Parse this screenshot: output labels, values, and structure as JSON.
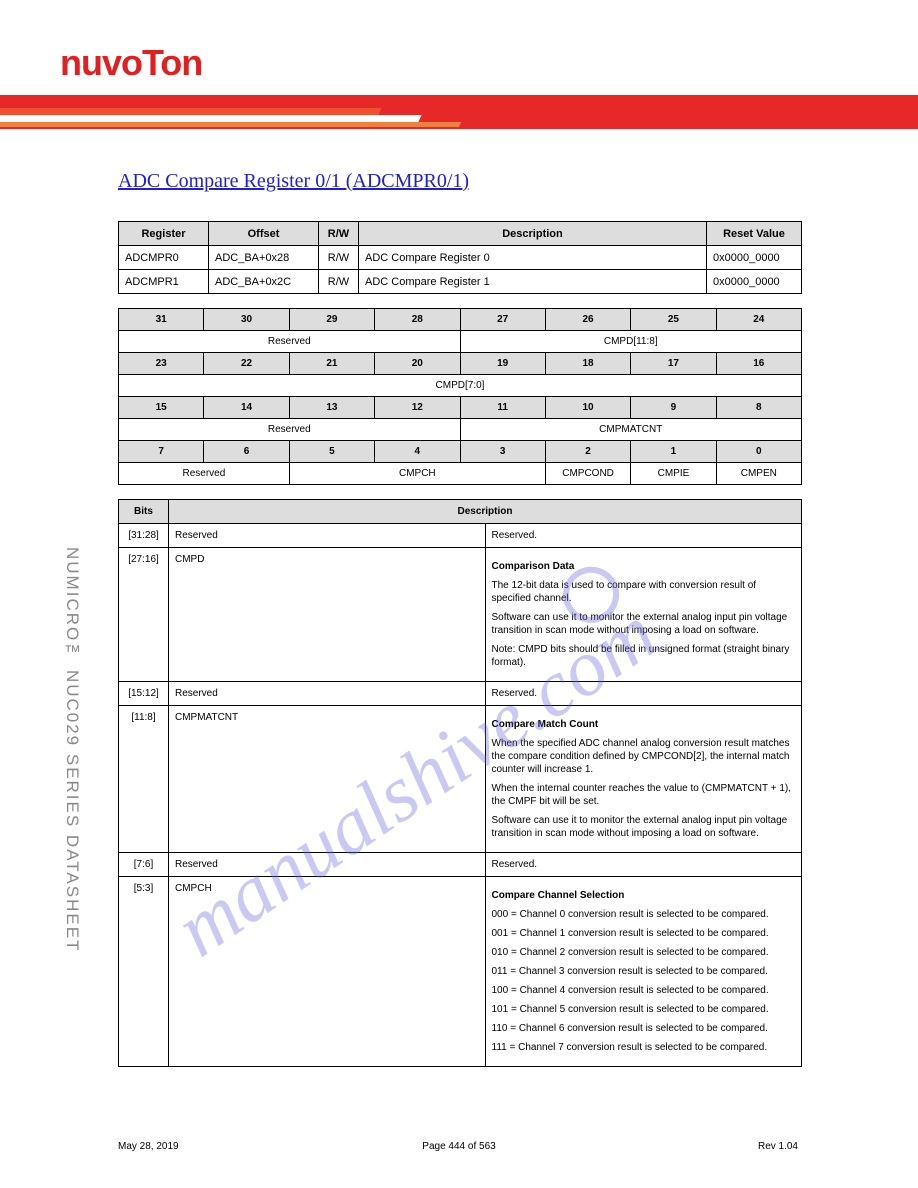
{
  "brand": "nuvoTon",
  "side_label": "NUMICRO™ NUC029 SERIES DATASHEET",
  "title_link": "ADC Compare Register 0/1 (ADCMPR0/1)",
  "watermark": "manualshive.com",
  "reg_table": {
    "headers": [
      "Register",
      "Offset",
      "R/W",
      "Description",
      "Reset Value"
    ],
    "rows": [
      [
        "ADCMPR0",
        "ADC_BA+0x28",
        "R/W",
        "ADC Compare Register 0",
        "0x0000_0000"
      ],
      [
        "ADCMPR1",
        "ADC_BA+0x2C",
        "R/W",
        "ADC Compare Register 1",
        "0x0000_0000"
      ]
    ]
  },
  "bit_table": {
    "rows": [
      {
        "hdr": [
          "31",
          "30",
          "29",
          "28",
          "27",
          "26",
          "25",
          "24"
        ],
        "val": [
          "Reserved",
          "",
          "",
          "",
          "CMPD[11:8]",
          "",
          "",
          ""
        ],
        "spans": [
          4,
          4
        ]
      },
      {
        "hdr": [
          "23",
          "22",
          "21",
          "20",
          "19",
          "18",
          "17",
          "16"
        ],
        "val": [
          "CMPD[7:0]"
        ],
        "spans": [
          8
        ]
      },
      {
        "hdr": [
          "15",
          "14",
          "13",
          "12",
          "11",
          "10",
          "9",
          "8"
        ],
        "val": [
          "Reserved",
          "",
          "",
          "",
          "CMPMATCNT",
          "",
          "",
          ""
        ],
        "spans": [
          4,
          4
        ]
      },
      {
        "hdr": [
          "7",
          "6",
          "5",
          "4",
          "3",
          "2",
          "1",
          "0"
        ],
        "val": [
          "Reserved",
          "",
          "CMPCH",
          "",
          "",
          "CMPCOND",
          "CMPIE",
          "CMPEN"
        ],
        "spans": [
          2,
          3,
          1,
          1,
          1,
          0,
          0,
          0
        ],
        "custom": true
      }
    ]
  },
  "desc_table": {
    "headers": [
      "Bits",
      "Description"
    ],
    "rows": [
      {
        "bits": "[31:28]",
        "field": "Reserved",
        "desc": [
          "Reserved."
        ]
      },
      {
        "bits": "[27:16]",
        "field": "CMPD",
        "desc": [
          "Comparison Data",
          "The 12-bit data is used to compare with conversion result of specified channel.",
          "Software can use it to monitor the external analog input pin voltage transition in scan mode without imposing a load on software.",
          "Note: CMPD bits should be filled in unsigned format (straight binary format)."
        ]
      },
      {
        "bits": "[15:12]",
        "field": "Reserved",
        "desc": [
          "Reserved."
        ]
      },
      {
        "bits": "[11:8]",
        "field": "CMPMATCNT",
        "desc": [
          "Compare Match Count",
          "When the specified ADC channel analog conversion result matches the compare condition defined by CMPCOND[2], the internal match counter will increase 1.",
          "When the internal counter reaches the value to (CMPMATCNT + 1), the CMPF bit will be set.",
          "Software can use it to monitor the external analog input pin voltage transition in scan mode without imposing a load on software."
        ]
      },
      {
        "bits": "[7:6]",
        "field": "Reserved",
        "desc": [
          "Reserved."
        ]
      },
      {
        "bits": "[5:3]",
        "field": "CMPCH",
        "desc": [
          "Compare Channel Selection",
          "000 = Channel 0 conversion result is selected to be compared.",
          "001 = Channel 1 conversion result is selected to be compared.",
          "010 = Channel 2 conversion result is selected to be compared.",
          "011 = Channel 3 conversion result is selected to be compared.",
          "100 = Channel 4 conversion result is selected to be compared.",
          "101 = Channel 5 conversion result is selected to be compared.",
          "110 = Channel 6 conversion result is selected to be compared.",
          "111 = Channel 7 conversion result is selected to be compared."
        ]
      }
    ]
  },
  "footer": {
    "left": "May 28, 2019",
    "center": "Page 444 of 563",
    "right": "Rev 1.04"
  }
}
